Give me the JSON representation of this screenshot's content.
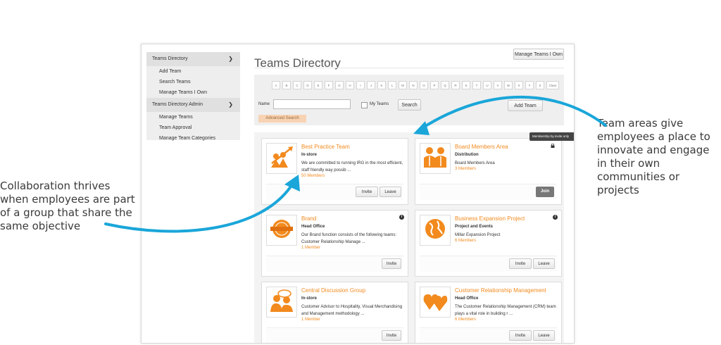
{
  "callouts": {
    "left": "Collaboration thrives when employees are part of a group that share the same objective",
    "right": "Team areas give employees a place to innovate and engage in their own communities or projects"
  },
  "sidebar": {
    "sections": [
      {
        "label": "Teams Directory",
        "items": [
          "Add Team",
          "Search Teams",
          "Manage Teams I Own"
        ]
      },
      {
        "label": "Teams Directory Admin",
        "items": [
          "Manage Teams",
          "Team Approval",
          "Manage Team Categories"
        ]
      }
    ]
  },
  "header": {
    "title": "Teams Directory",
    "manage_button": "Manage Teams I Own"
  },
  "search": {
    "letters": [
      "A",
      "B",
      "C",
      "D",
      "E",
      "F",
      "G",
      "H",
      "I",
      "J",
      "K",
      "L",
      "M",
      "N",
      "O",
      "P",
      "Q",
      "R",
      "S",
      "T",
      "U",
      "V",
      "W",
      "X",
      "Y",
      "Z"
    ],
    "clear_label": "Clear",
    "name_label": "Name",
    "name_value": "",
    "my_teams_label": "My Teams",
    "search_button": "Search",
    "add_team_button": "Add Team",
    "advanced_search": "Advanced Search"
  },
  "tooltip": "Membership by invite only",
  "cards": [
    {
      "name": "Best Practice Team",
      "category": "In-store",
      "description": "We are committed to running IRG in the most efficient, staff friendly way possib ...",
      "members": "50 Members",
      "buttons": [
        "Invite",
        "Leave"
      ],
      "icon": "growth-team-icon",
      "info": false
    },
    {
      "name": "Board Members Area",
      "category": "Distribution",
      "description": "Board Members Area",
      "members": "3 Members",
      "buttons": [
        "Join"
      ],
      "icon": "board-members-icon",
      "info": false
    },
    {
      "name": "Brand",
      "category": "Head Office",
      "description": "Our Brand function consists of the following teams: Customer Relationship Manage ...",
      "members": "1 Member",
      "buttons": [
        "Invite"
      ],
      "icon": "brand-seal-icon",
      "info": true
    },
    {
      "name": "Business Expansion Project",
      "category": "Project and Events",
      "description": "Millar Expansion Project",
      "members": "6 Members",
      "buttons": [
        "Invite",
        "Leave"
      ],
      "icon": "globe-icon",
      "info": true
    },
    {
      "name": "Central Discussion Group",
      "category": "In-store",
      "description": "Customer Advisor to Hospitality, Visual Merchandising and Management methodology ...",
      "members": "1 Member",
      "buttons": [
        "Invite"
      ],
      "icon": "discussion-icon",
      "info": false
    },
    {
      "name": "Customer Relationship Management",
      "category": "Head Office",
      "description": "The Customer Relationship Management (CRM) team plays a vital role in building r ...",
      "members": "6 Members",
      "buttons": [
        "Invite",
        "Leave"
      ],
      "icon": "hearts-icon",
      "info": false
    }
  ],
  "colors": {
    "accent": "#f28a1e",
    "arrow": "#1aa6d9",
    "join": "#777777"
  }
}
